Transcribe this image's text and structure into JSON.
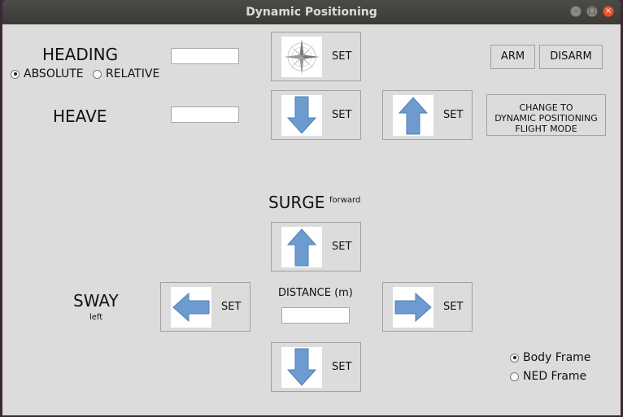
{
  "window": {
    "title": "Dynamic Positioning"
  },
  "heading": {
    "label": "HEADING",
    "absolute_label": "ABSOLUTE",
    "relative_label": "RELATIVE",
    "absolute_selected": true,
    "input_value": "",
    "set_label": "SET"
  },
  "heave": {
    "label": "HEAVE",
    "input_value": "",
    "down_set_label": "SET",
    "up_set_label": "SET"
  },
  "arm_label": "ARM",
  "disarm_label": "DISARM",
  "change_mode": {
    "line1": "CHANGE TO",
    "line2": "DYNAMIC POSITIONING",
    "line3": "FLIGHT MODE"
  },
  "surge": {
    "label": "SURGE",
    "sublabel": "forward",
    "forward_set_label": "SET",
    "back_set_label": "SET"
  },
  "sway": {
    "label": "SWAY",
    "sublabel": "left",
    "left_set_label": "SET",
    "right_set_label": "SET"
  },
  "distance": {
    "label": "DISTANCE (m)",
    "input_value": ""
  },
  "frame": {
    "body_label": "Body Frame",
    "ned_label": "NED Frame",
    "selected": "Body Frame"
  },
  "colors": {
    "arrow": "#6d9bd0",
    "arrow_stroke": "#4f7fb5",
    "titlebar": "#3c3b37",
    "close": "#e9562d"
  },
  "icons": [
    "compass-rose-icon",
    "arrow-down-icon",
    "arrow-up-icon",
    "arrow-left-icon",
    "arrow-right-icon"
  ]
}
